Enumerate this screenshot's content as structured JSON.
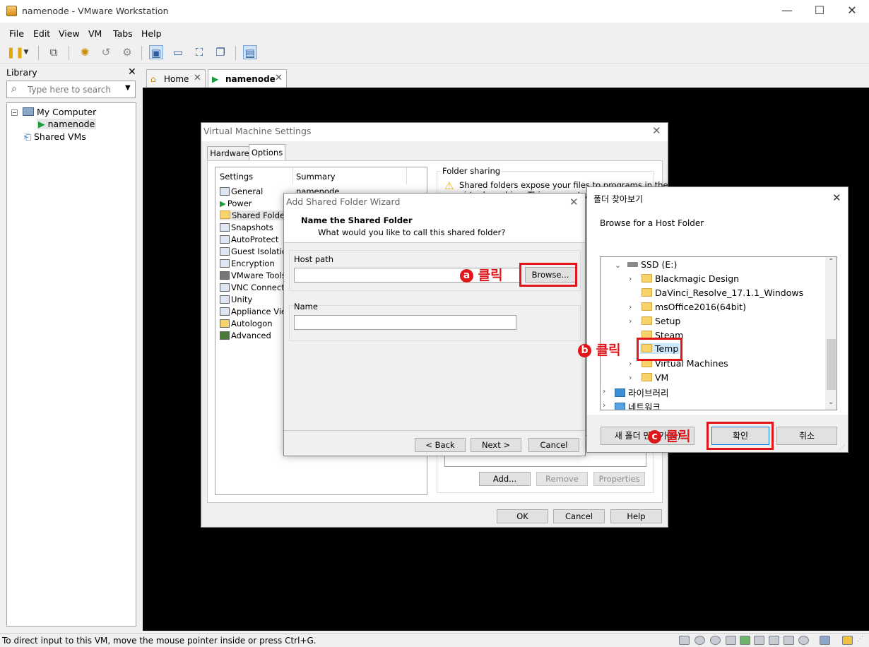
{
  "window": {
    "title": "namenode - VMware Workstation",
    "minimize": "—",
    "maximize": "☐",
    "close": "✕"
  },
  "menu": [
    "File",
    "Edit",
    "View",
    "VM",
    "Tabs",
    "Help"
  ],
  "library": {
    "title": "Library",
    "close": "✕",
    "search_placeholder": "Type here to search",
    "tree": {
      "my_computer": "My Computer",
      "namenode": "namenode",
      "shared_vms": "Shared VMs"
    }
  },
  "tabs": [
    {
      "label": "Home"
    },
    {
      "label": "namenode"
    }
  ],
  "status_text": "To direct input to this VM, move the mouse pointer inside or press Ctrl+G.",
  "vm_settings": {
    "title": "Virtual Machine Settings",
    "tabs": [
      "Hardware",
      "Options"
    ],
    "headers": {
      "settings": "Settings",
      "summary": "Summary"
    },
    "items": [
      "General",
      "Power",
      "Shared Folders",
      "Snapshots",
      "AutoProtect",
      "Guest Isolation",
      "Encryption",
      "VMware Tools",
      "VNC Connection",
      "Unity",
      "Appliance View",
      "Autologon",
      "Advanced"
    ],
    "summary_first": "namenode",
    "folder_sharing": {
      "label": "Folder sharing",
      "text_line1": "Shared folders expose your files to programs in the",
      "text_line2": "virtual machine. This may put your co"
    },
    "buttons": {
      "add": "Add...",
      "remove": "Remove",
      "properties": "Properties",
      "ok": "OK",
      "cancel": "Cancel",
      "help": "Help"
    }
  },
  "wizard": {
    "title": "Add Shared Folder Wizard",
    "heading": "Name the Shared Folder",
    "subheading": "What would you like to call this shared folder?",
    "host_path_label": "Host path",
    "host_path_value": "",
    "browse": "Browse...",
    "name_label": "Name",
    "name_value": "",
    "back": "< Back",
    "next": "Next >",
    "cancel": "Cancel"
  },
  "browse_dialog": {
    "title": "폴더 찾아보기",
    "description": "Browse for a Host Folder",
    "drive": "SSD (E:)",
    "folders": [
      "Blackmagic Design",
      "DaVinci_Resolve_17.1.1_Windows",
      "msOffice2016(64bit)",
      "Setup",
      "Steam",
      "Temp",
      "Virtual Machines",
      "VM"
    ],
    "library": "라이브러리",
    "network": "네트워크",
    "new_folder": "새 폴더 만들기(M)",
    "ok": "확인",
    "cancel": "취소"
  },
  "annotations": {
    "a": {
      "mark": "a",
      "text": "클릭"
    },
    "b": {
      "mark": "b",
      "text": "클릭"
    },
    "c": {
      "mark": "c",
      "text": "클릭"
    }
  },
  "colors": {
    "annotation": "#e0161b",
    "vm_background": "#000000"
  }
}
